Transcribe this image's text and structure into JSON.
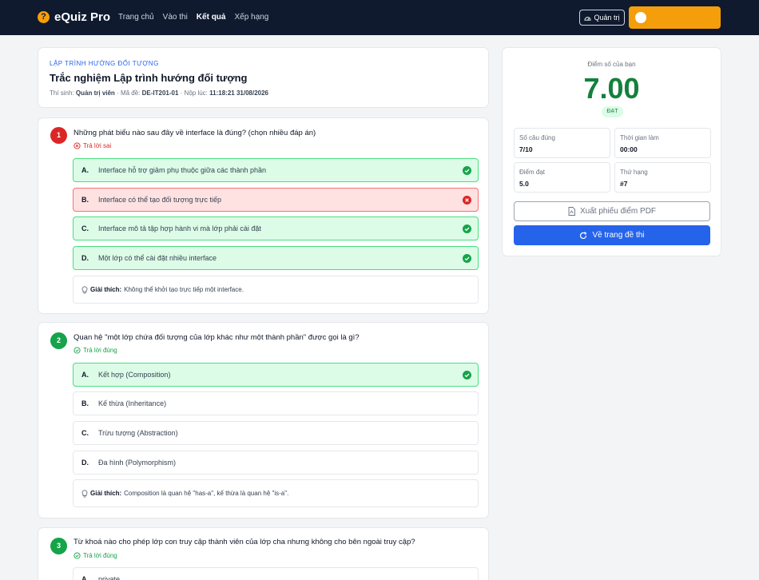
{
  "nav": {
    "brand": "eQuiz Pro",
    "brand_icon": "?",
    "links": [
      "Trang chủ",
      "Vào thi",
      "Kết quả",
      "Xếp hạng"
    ],
    "active_link": "Kết quả",
    "admin_label": "Quản trị"
  },
  "exam": {
    "subject": "LẬP TRÌNH HƯỚNG ĐỐI TƯỢNG",
    "title": "Trắc nghiệm Lập trình hướng đối tượng",
    "candidate_label": "Thí sinh:",
    "candidate": "Quản trị viên",
    "code_label": "· Mã đề:",
    "code": "DE-IT201-01",
    "submitted_label": "· Nộp lúc:",
    "submitted": "11:18:21 31/08/2026"
  },
  "questions": [
    {
      "number": "1",
      "text": "Những phát biểu nào sau đây về interface là đúng? (chọn nhiều đáp án)",
      "status": "Trả lời sai",
      "options": [
        {
          "letter": "A.",
          "text": "Interface hỗ trợ giảm phụ thuộc giữa các thành phần",
          "state": "correct"
        },
        {
          "letter": "B.",
          "text": "Interface có thể tạo đối tượng trực tiếp",
          "state": "incorrect"
        },
        {
          "letter": "C.",
          "text": "Interface mô tả tập hợp hành vi mà lớp phải cài đặt",
          "state": "correct"
        },
        {
          "letter": "D.",
          "text": "Một lớp có thể cài đặt nhiều interface",
          "state": "correct"
        }
      ],
      "explain_label": "Giải thích:",
      "explanation": "Không thể khởi tạo trực tiếp một interface."
    },
    {
      "number": "2",
      "text": "Quan hệ \"một lớp chứa đối tượng của lớp khác như một thành phần\" được gọi là gì?",
      "status": "Trả lời đúng",
      "options": [
        {
          "letter": "A.",
          "text": "Kết hợp (Composition)",
          "state": "correct"
        },
        {
          "letter": "B.",
          "text": "Kế thừa (Inheritance)",
          "state": "none"
        },
        {
          "letter": "C.",
          "text": "Trừu tượng (Abstraction)",
          "state": "none"
        },
        {
          "letter": "D.",
          "text": "Đa hình (Polymorphism)",
          "state": "none"
        }
      ],
      "explain_label": "Giải thích:",
      "explanation": "Composition là quan hệ \"has-a\", kế thừa là quan hệ \"is-a\"."
    },
    {
      "number": "3",
      "text": "Từ khoá nào cho phép lớp con truy cập thành viên của lớp cha nhưng không cho bên ngoài truy cập?",
      "status": "Trả lời đúng",
      "options": [
        {
          "letter": "A.",
          "text": "private",
          "state": "none"
        }
      ]
    }
  ],
  "score": {
    "label": "Điểm số của bạn",
    "value": "7.00",
    "badge": "ĐẠT",
    "stats": [
      {
        "label": "Số câu đúng",
        "value": "7/10"
      },
      {
        "label": "Thời gian làm",
        "value": "00:00"
      },
      {
        "label": "Điểm đạt",
        "value": "5.0"
      },
      {
        "label": "Thứ hạng",
        "value": "#7"
      }
    ],
    "pdf_label": "Xuất phiếu điểm PDF",
    "back_label": "Về trang đề thi"
  },
  "colors": {
    "navbar": "#0f1a2e",
    "accent": "#f59e0b",
    "primary": "#2563eb",
    "correct": "#16a34a",
    "wrong": "#dc2626"
  }
}
